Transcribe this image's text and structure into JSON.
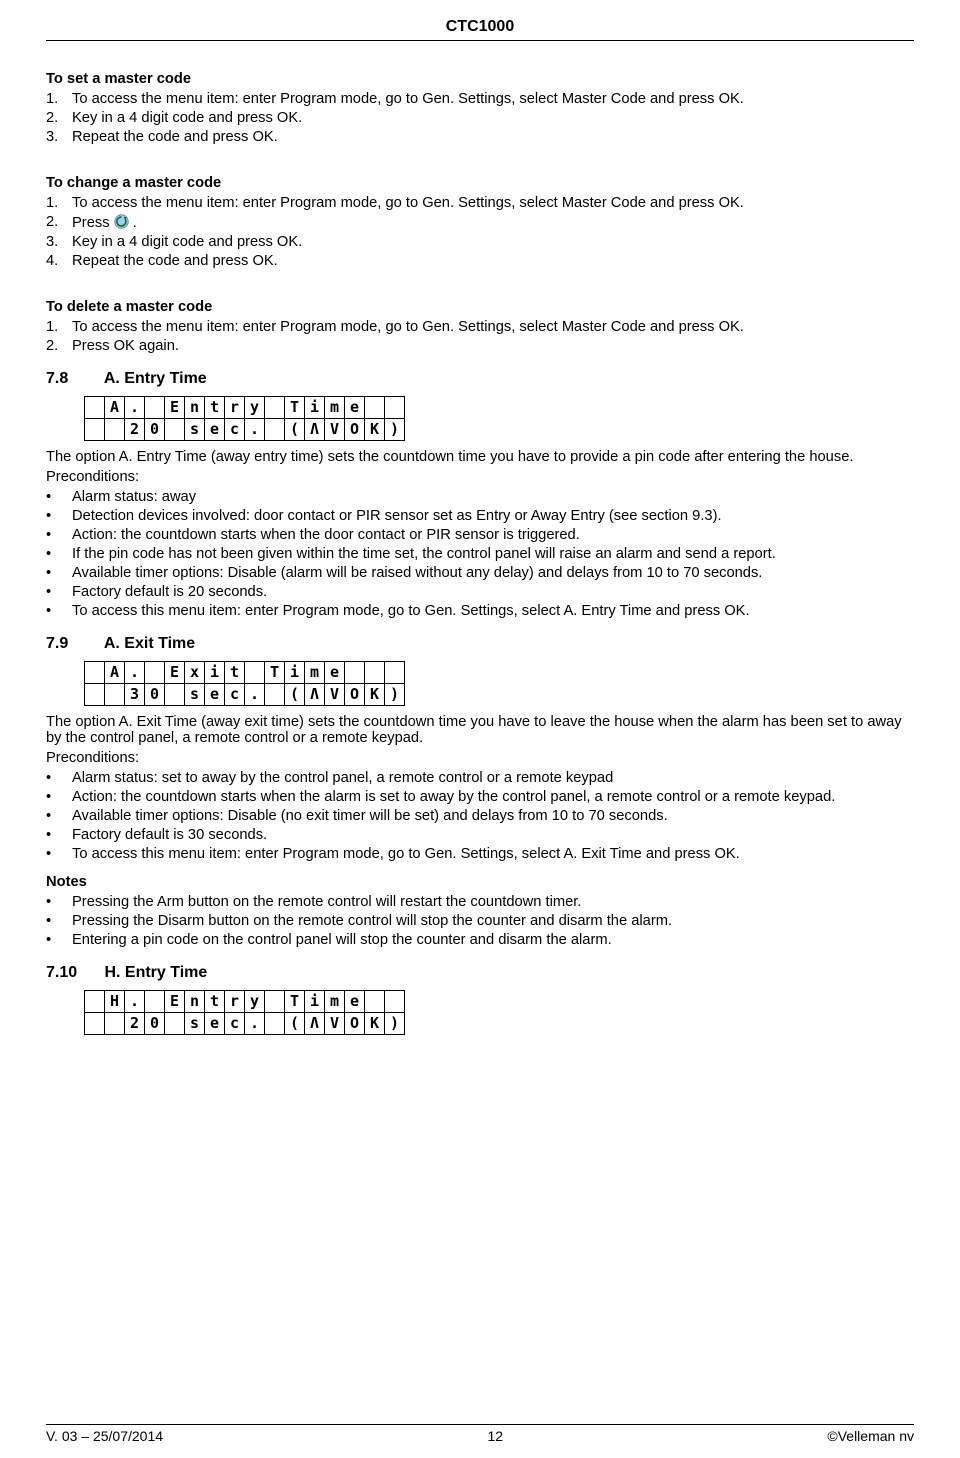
{
  "header": {
    "title": "CTC1000"
  },
  "s1": {
    "title": "To set a master code",
    "items": [
      "To access the menu item: enter Program mode, go to Gen. Settings, select Master Code and press OK.",
      "Key in a 4 digit code and press OK.",
      "Repeat the code and press OK."
    ]
  },
  "s2": {
    "title": "To change a master code",
    "i1": "To access the menu item: enter Program mode, go to Gen. Settings, select Master Code and press OK.",
    "i2a": "Press ",
    "i2b": ".",
    "i3": "Key in a 4 digit code and press OK.",
    "i4": "Repeat the code and press OK."
  },
  "s3": {
    "title": "To delete a master code",
    "items": [
      "To access the menu item: enter Program mode, go to Gen. Settings, select Master Code and press OK.",
      "Press OK again."
    ]
  },
  "sec78": {
    "num": "7.8",
    "title": "A. Entry Time"
  },
  "lcd78": {
    "row0": [
      " ",
      "A",
      ".",
      " ",
      "E",
      "n",
      "t",
      "r",
      "y",
      " ",
      "T",
      "i",
      "m",
      "e",
      " ",
      " "
    ],
    "row1": [
      " ",
      " ",
      "2",
      "0",
      " ",
      "s",
      "e",
      "c",
      ".",
      " ",
      "(",
      "Ʌ",
      "V",
      "O",
      "K",
      ")"
    ]
  },
  "p78": {
    "intro": "The option A. Entry Time (away entry time) sets the countdown time you have to provide a pin code after entering the house.",
    "pre": "Preconditions:",
    "bullets": [
      "Alarm status: away",
      "Detection devices involved: door contact or PIR sensor set as Entry or Away Entry (see section 9.3).",
      "Action: the countdown starts when the door contact or PIR sensor is triggered.",
      "If the pin code has not been given within the time set, the control panel will raise an alarm and send a report.",
      "Available timer options: Disable (alarm will be raised without any delay) and delays from 10 to 70 seconds.",
      "Factory default is 20 seconds.",
      "To access this menu item: enter Program mode, go to Gen. Settings, select A. Entry Time and press OK."
    ]
  },
  "sec79": {
    "num": "7.9",
    "title": "A. Exit Time"
  },
  "lcd79": {
    "row0": [
      " ",
      "A",
      ".",
      " ",
      "E",
      "x",
      "i",
      "t",
      " ",
      "T",
      "i",
      "m",
      "e",
      " ",
      " ",
      " "
    ],
    "row1": [
      " ",
      " ",
      "3",
      "0",
      " ",
      "s",
      "e",
      "c",
      ".",
      " ",
      "(",
      "Ʌ",
      "V",
      "O",
      "K",
      ")"
    ]
  },
  "p79": {
    "intro": "The option A. Exit Time (away exit time) sets the countdown time you have to leave the house when the alarm has been set to away by the control panel, a remote control or a remote keypad.",
    "pre": "Preconditions:",
    "bullets": [
      "Alarm status: set to away by the control panel, a remote control or a remote keypad",
      "Action: the countdown starts when the alarm is set to away by the control panel, a remote control or a remote keypad.",
      "Available timer options: Disable (no exit timer will be set) and delays from 10 to 70 seconds.",
      "Factory default is 30 seconds.",
      "To access this menu item: enter Program mode, go to Gen. Settings, select A. Exit Time and press OK."
    ]
  },
  "notes": {
    "title": "Notes",
    "bullets": [
      "Pressing the Arm button on the remote control will restart the countdown timer.",
      "Pressing the Disarm button on the remote control will stop the counter and disarm the alarm.",
      "Entering a pin code on the control panel will stop the counter and disarm the alarm."
    ]
  },
  "sec710": {
    "num": "7.10",
    "title": "H. Entry Time"
  },
  "lcd710": {
    "row0": [
      " ",
      "H",
      ".",
      " ",
      "E",
      "n",
      "t",
      "r",
      "y",
      " ",
      "T",
      "i",
      "m",
      "e",
      " ",
      " "
    ],
    "row1": [
      " ",
      " ",
      "2",
      "0",
      " ",
      "s",
      "e",
      "c",
      ".",
      " ",
      "(",
      "Ʌ",
      "V",
      "O",
      "K",
      ")"
    ]
  },
  "footer": {
    "left": "V. 03 – 25/07/2014",
    "center": "12",
    "right": "©Velleman nv"
  }
}
